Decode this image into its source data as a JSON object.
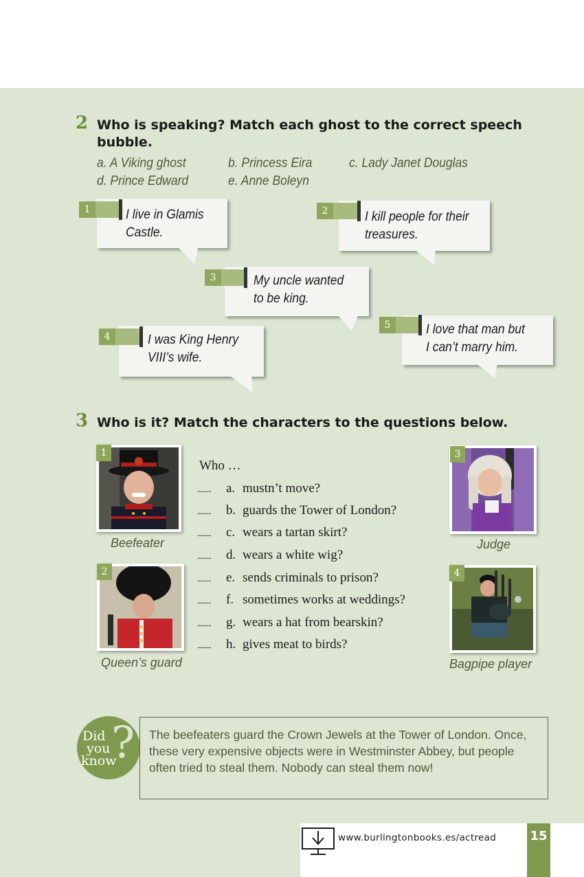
{
  "exercise2": {
    "number": "2",
    "title_line1": "Who is speaking? Match each ghost to the correct speech",
    "title_line2": "bubble.",
    "options": [
      "a. A Viking ghost",
      "b. Princess Eira",
      "c. Lady Janet Douglas",
      "d. Prince Edward",
      "e. Anne Boleyn"
    ],
    "bubbles": [
      {
        "number": "1",
        "line1": "I live in Glamis",
        "line2": "Castle."
      },
      {
        "number": "2",
        "line1": "I kill people for their",
        "line2": "treasures."
      },
      {
        "number": "3",
        "line1": "My uncle wanted",
        "line2": "to be king."
      },
      {
        "number": "4",
        "line1": "I was King Henry",
        "line2": "VIII’s wife."
      },
      {
        "number": "5",
        "line1": "I love that man but",
        "line2": "I can’t marry him."
      }
    ]
  },
  "exercise3": {
    "number": "3",
    "title": "Who is it? Match the characters to the questions below.",
    "who_label": "Who …",
    "answer_blank": "..........",
    "questions": [
      {
        "letter": "a.",
        "text": "mustn’t move?"
      },
      {
        "letter": "b.",
        "text": "guards the Tower of London?"
      },
      {
        "letter": "c.",
        "text": "wears a tartan skirt?"
      },
      {
        "letter": "d.",
        "text": "wears a white wig?"
      },
      {
        "letter": "e.",
        "text": "sends criminals to prison?"
      },
      {
        "letter": "f.",
        "text": "sometimes works at weddings?"
      },
      {
        "letter": "g.",
        "text": "wears a hat from bearskin?"
      },
      {
        "letter": "h.",
        "text": "gives meat to birds?"
      }
    ],
    "characters": [
      {
        "number": "1",
        "caption": "Beefeater"
      },
      {
        "number": "2",
        "caption": "Queen’s guard"
      },
      {
        "number": "3",
        "caption": "Judge"
      },
      {
        "number": "4",
        "caption": "Bagpipe player"
      }
    ]
  },
  "did_you_know": {
    "word1": "Did",
    "word2": "you",
    "word3": "know",
    "text": "The beefeaters guard the Crown Jewels at the Tower of London. Once, these very expensive objects were in Westminster Abbey, but people often tried to steal them. Nobody can steal them now!"
  },
  "footer": {
    "url": "www.burlingtonbooks.es/actread",
    "page_number": "15"
  },
  "colors": {
    "page_background": "#dde6d3",
    "accent_green": "#7f9a4f",
    "badge_green": "#8fa75c",
    "bubble": "#f4f4f1",
    "option_text": "#4e5a3a"
  }
}
